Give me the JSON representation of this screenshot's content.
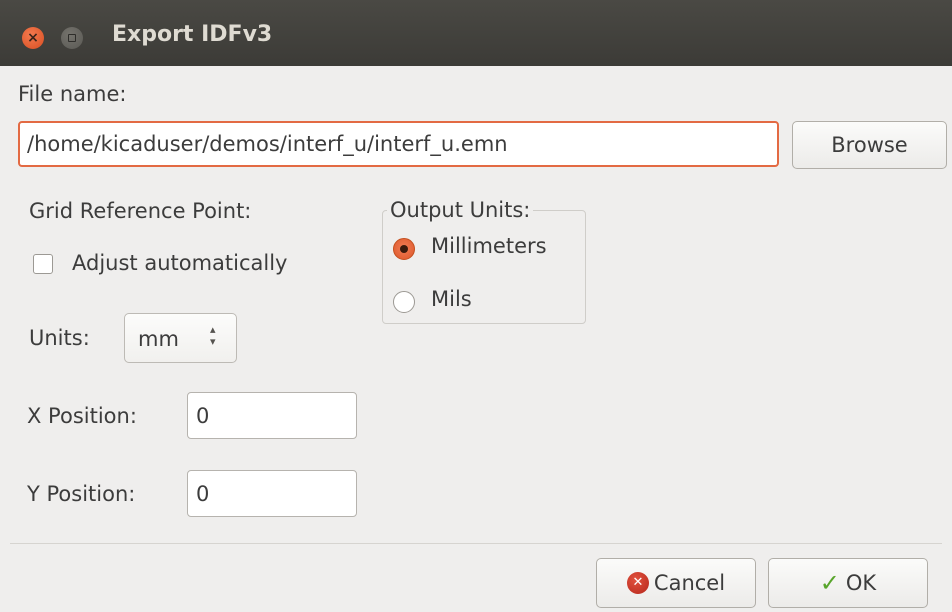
{
  "window": {
    "title": "Export IDFv3",
    "close_glyph": "×"
  },
  "file": {
    "label": "File name:",
    "value": "/home/kicaduser/demos/interf_u/interf_u.emn",
    "browse_label": "Browse"
  },
  "grid": {
    "label": "Grid Reference Point:",
    "adjust_label": "Adjust automatically",
    "adjust_checked": false,
    "units_label": "Units:",
    "units_value": "mm",
    "x_label": "X Position:",
    "x_value": "0",
    "y_label": "Y Position:",
    "y_value": "0"
  },
  "output_units": {
    "label": "Output Units:",
    "options": [
      {
        "label": "Millimeters",
        "checked": true
      },
      {
        "label": "Mils",
        "checked": false
      }
    ]
  },
  "buttons": {
    "cancel_label": "Cancel",
    "ok_label": "OK",
    "cancel_glyph": "✕",
    "ok_glyph": "✓"
  },
  "colors": {
    "accent": "#e36a43",
    "titlebar": "#3c3b37",
    "background": "#efeeed"
  }
}
